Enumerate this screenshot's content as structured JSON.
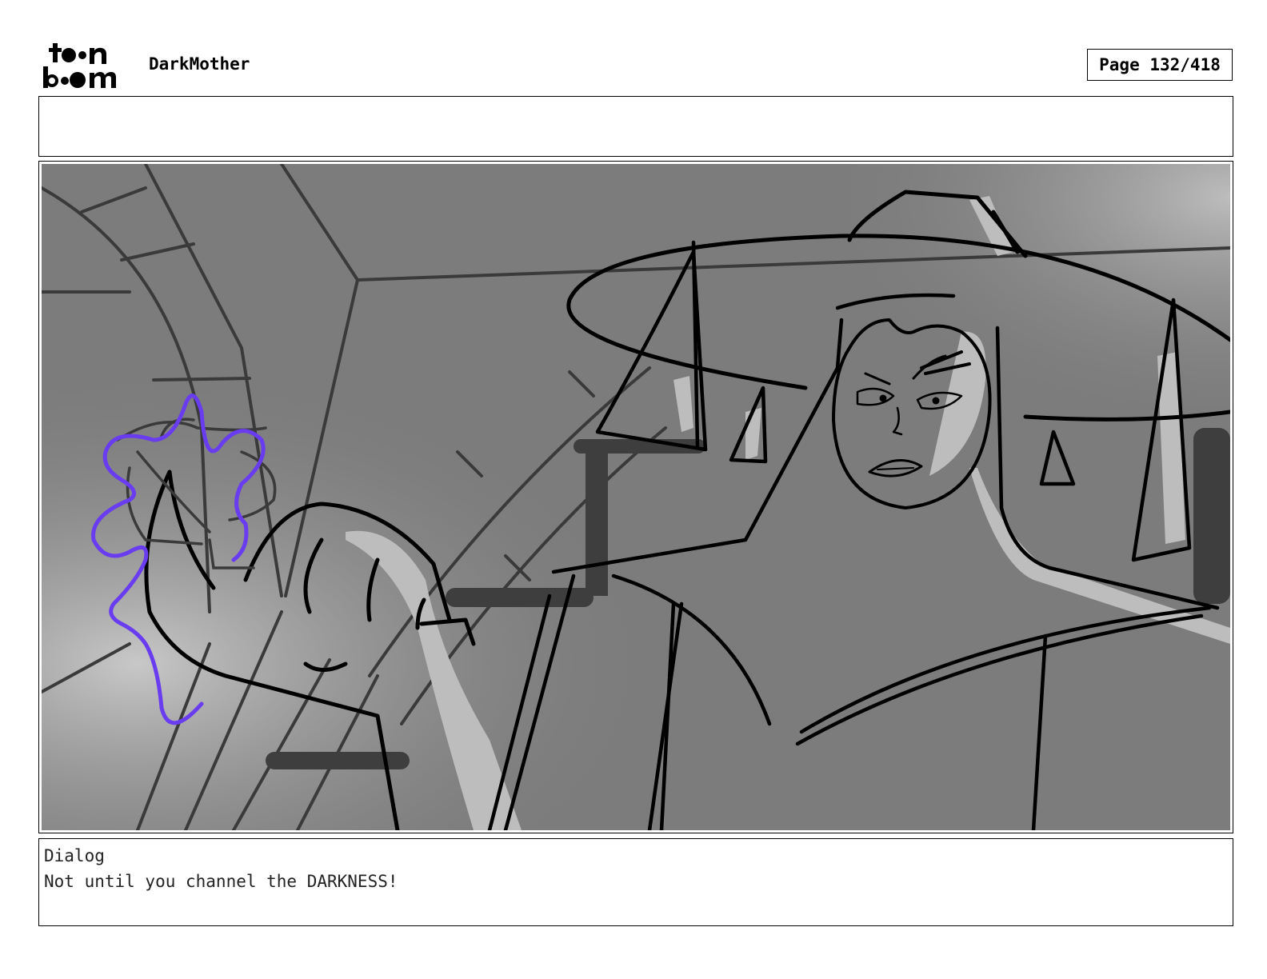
{
  "header": {
    "logo_text": "toon boom",
    "project_title": "DarkMother",
    "page_counter": "Page 132/418"
  },
  "notes": {
    "text": ""
  },
  "panel": {
    "palette": {
      "background": "#7c7c7c",
      "light": "#bdbdbd",
      "dark": "#3e3e3e",
      "ink": "#000000",
      "magic": "#6a3cf0"
    }
  },
  "dialog": {
    "label": "Dialog",
    "text": "Not until you channel the DARKNESS!"
  }
}
